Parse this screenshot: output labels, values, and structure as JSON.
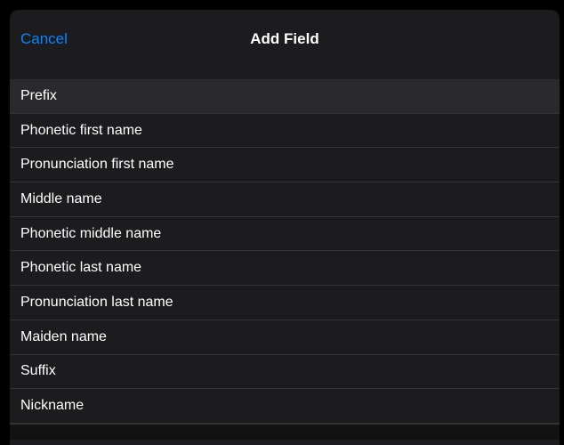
{
  "header": {
    "cancel_label": "Cancel",
    "title": "Add Field"
  },
  "fields": [
    {
      "label": "Prefix",
      "highlighted": true
    },
    {
      "label": "Phonetic first name",
      "highlighted": false
    },
    {
      "label": "Pronunciation first name",
      "highlighted": false
    },
    {
      "label": "Middle name",
      "highlighted": false
    },
    {
      "label": "Phonetic middle name",
      "highlighted": false
    },
    {
      "label": "Phonetic last name",
      "highlighted": false
    },
    {
      "label": "Pronunciation last name",
      "highlighted": false
    },
    {
      "label": "Maiden name",
      "highlighted": false
    },
    {
      "label": "Suffix",
      "highlighted": false
    },
    {
      "label": "Nickname",
      "highlighted": false
    }
  ]
}
